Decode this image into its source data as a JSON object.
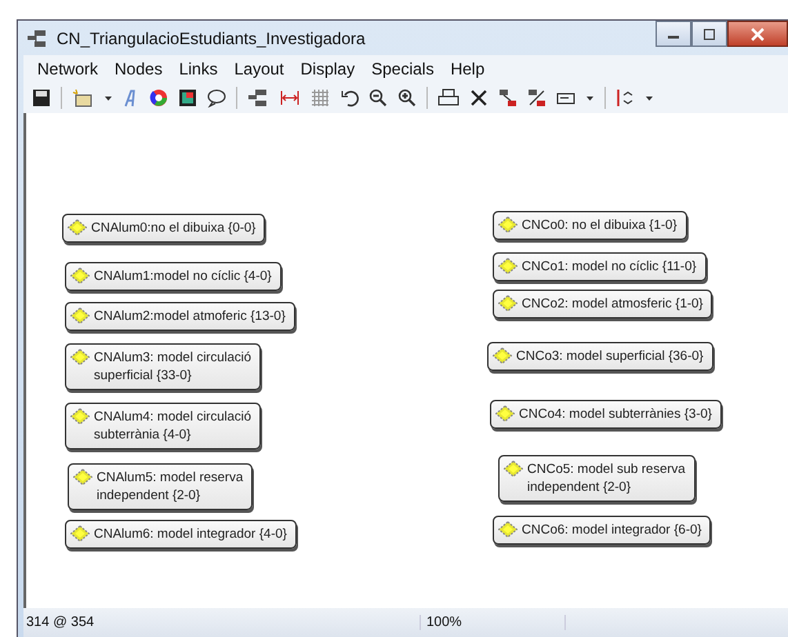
{
  "window": {
    "title": "CN_TriangulacioEstudiants_Investigadora"
  },
  "menu": [
    "Network",
    "Nodes",
    "Links",
    "Layout",
    "Display",
    "Specials",
    "Help"
  ],
  "nodes_left": [
    {
      "label": "CNAlum0:no el dibuixa {0-0}"
    },
    {
      "label": "CNAlum1:model no cíclic {4-0}"
    },
    {
      "label": "CNAlum2:model atmoferic {13-0}"
    },
    {
      "label": "CNAlum3: model circulació\nsuperficial {33-0}"
    },
    {
      "label": "CNAlum4: model circulació\nsubterrània {4-0}"
    },
    {
      "label": "CNAlum5: model reserva\nindependent {2-0}"
    },
    {
      "label": "CNAlum6: model integrador {4-0}"
    }
  ],
  "nodes_right": [
    {
      "label": "CNCo0: no el dibuixa {1-0}"
    },
    {
      "label": "CNCo1: model no cíclic {11-0}"
    },
    {
      "label": "CNCo2: model atmosferic {1-0}"
    },
    {
      "label": "CNCo3: model superficial {36-0}"
    },
    {
      "label": "CNCo4: model subterrànies {3-0}"
    },
    {
      "label": "CNCo5: model sub reserva\nindependent {2-0}"
    },
    {
      "label": "CNCo6: model integrador {6-0}"
    }
  ],
  "status_bar": {
    "position": "314 @ 354",
    "zoom": "100%"
  }
}
